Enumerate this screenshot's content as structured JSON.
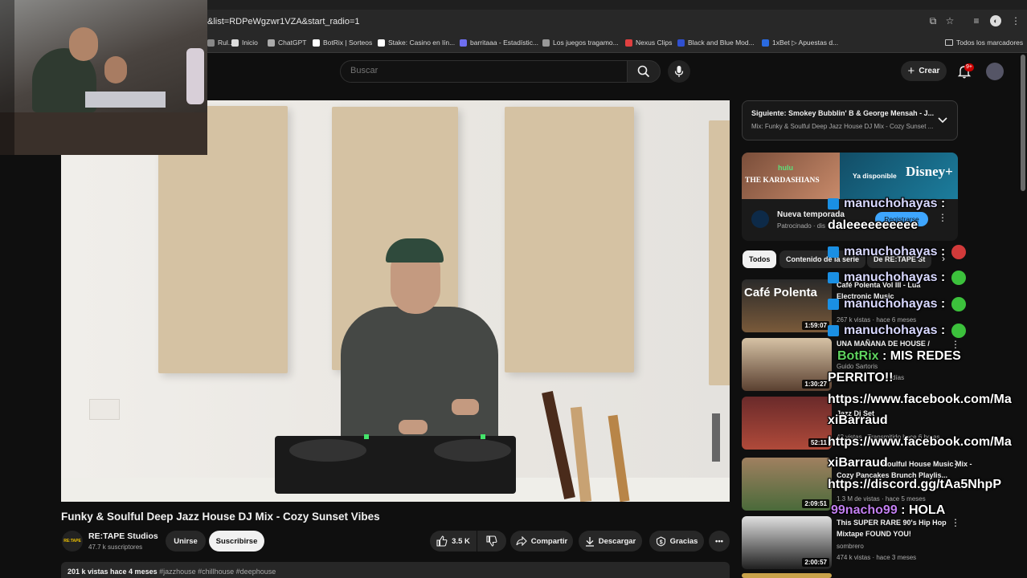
{
  "browser": {
    "url": "&list=RDPeWgzwr1VZA&start_radio=1",
    "bookmarks": [
      {
        "label": "Rul..",
        "color": "#888888"
      },
      {
        "label": "Inicio",
        "color": "#dddddd"
      },
      {
        "label": "ChatGPT",
        "color": "#aaaaaa"
      },
      {
        "label": "BotRix | Sorteos",
        "color": "#ffffff"
      },
      {
        "label": "Stake: Casino en lín...",
        "color": "#ffffff"
      },
      {
        "label": "barritaaa - Estadístic...",
        "color": "#6f6ff0"
      },
      {
        "label": "Los juegos tragamo...",
        "color": "#999999"
      },
      {
        "label": "Nexus Clips",
        "color": "#e04040"
      },
      {
        "label": "Black and Blue Mod...",
        "color": "#3050d0"
      },
      {
        "label": "1xBet ▷ Apuestas d...",
        "color": "#2a6ae0"
      }
    ],
    "all_bookmarks": "Todos los marcadores"
  },
  "header": {
    "search_placeholder": "Buscar",
    "create_label": "Crear",
    "notif_count": "9+"
  },
  "video": {
    "title": "Funky & Soulful Deep Jazz House DJ Mix - Cozy Sunset Vibes",
    "channel": "RE:TAPE Studios",
    "channel_logo_text": "RE:TAPE",
    "subscribers": "47.7 k suscriptores",
    "join_label": "Unirse",
    "subscribe_label": "Suscribirse",
    "likes": "3.5 K",
    "share_label": "Compartir",
    "download_label": "Descargar",
    "thanks_label": "Gracias",
    "views_date": "201 k vistas  hace 4 meses",
    "tags": "#jazzhouse #chillhouse #deephouse"
  },
  "sidebar": {
    "next_line1": "Siguiente: Smokey Bubblin' B & George Mensah - J...",
    "next_line2": "Mix: Funky & Soulful Deep Jazz House DJ Mix - Cozy Sunset ...",
    "ad": {
      "brand_left": "THE KARDASHIANS",
      "brand_top": "hulu",
      "brand_right": "Ya disponible",
      "title": "Nueva temporada",
      "sponsored": "Patrocinado · dis",
      "cta": "Registrarse"
    },
    "chips": [
      "Todos",
      "Contenido de la serie",
      "De RE:TAPE St"
    ],
    "items": [
      {
        "title": "Café Polenta Vol III - Lua",
        "line2": "Electronic Music",
        "meta": "267 k vistas · hace 6 meses",
        "duration": "1:59:07",
        "thumb_text": "Café Polenta"
      },
      {
        "title": "UNA MAÑANA DE HOUSE /",
        "line2": "Guido Sartoris",
        "meta": "días",
        "duration": "1:30:27",
        "thumb_text": ""
      },
      {
        "title": "Jazz Dj Set",
        "line2": "",
        "meta": "42 vistas · Transmitido hace 6 horas",
        "duration": "52:11",
        "thumb_text": ""
      },
      {
        "title": "Soulful House Music Mix -",
        "line2": "Cozy Pancakes Brunch Playlis...",
        "meta": "1.3 M de vistas · hace 5 meses",
        "duration": "2:09:51",
        "thumb_text": ""
      },
      {
        "title": "This SUPER RARE 90's Hip Hop",
        "line2": "Mixtape FOUND YOU!",
        "meta": "474 k vistas · hace 3 meses",
        "author": "sombrero",
        "duration": "2:00:57",
        "thumb_text": ""
      }
    ]
  },
  "chat": [
    {
      "user": "manuchohayas",
      "sep": " :",
      "text": "",
      "emote": ""
    },
    {
      "user": "",
      "sep": "",
      "text": "daleeeeeeeeee",
      "emote": ""
    },
    {
      "user": "manuchohayas",
      "sep": " :",
      "text": "",
      "emote": "#d23a3a"
    },
    {
      "user": "manuchohayas",
      "sep": " :",
      "text": "",
      "emote": "#3cc13c"
    },
    {
      "user": "manuchohayas",
      "sep": " :",
      "text": "",
      "emote": "#3cc13c"
    },
    {
      "user": "manuchohayas",
      "sep": " :",
      "text": "",
      "emote": "#3cc13c"
    },
    {
      "user": "BotRix",
      "sep": " : ",
      "text": "MIS REDES",
      "emote": ""
    },
    {
      "user": "",
      "sep": "",
      "text": "PERRITO!!",
      "emote": ""
    },
    {
      "user": "",
      "sep": "",
      "text": "https://www.facebook.com/Ma",
      "emote": ""
    },
    {
      "user": "",
      "sep": "",
      "text": "xiBarraud",
      "emote": ""
    },
    {
      "user": "",
      "sep": "",
      "text": "https://www.facebook.com/Ma",
      "emote": ""
    },
    {
      "user": "",
      "sep": "",
      "text": "xiBarraud",
      "emote": ""
    },
    {
      "user": "",
      "sep": "",
      "text": "https://discord.gg/tAa5NhpP",
      "emote": ""
    },
    {
      "user": "99nacho99",
      "sep": " : ",
      "text": "HOLA",
      "emote": ""
    }
  ]
}
